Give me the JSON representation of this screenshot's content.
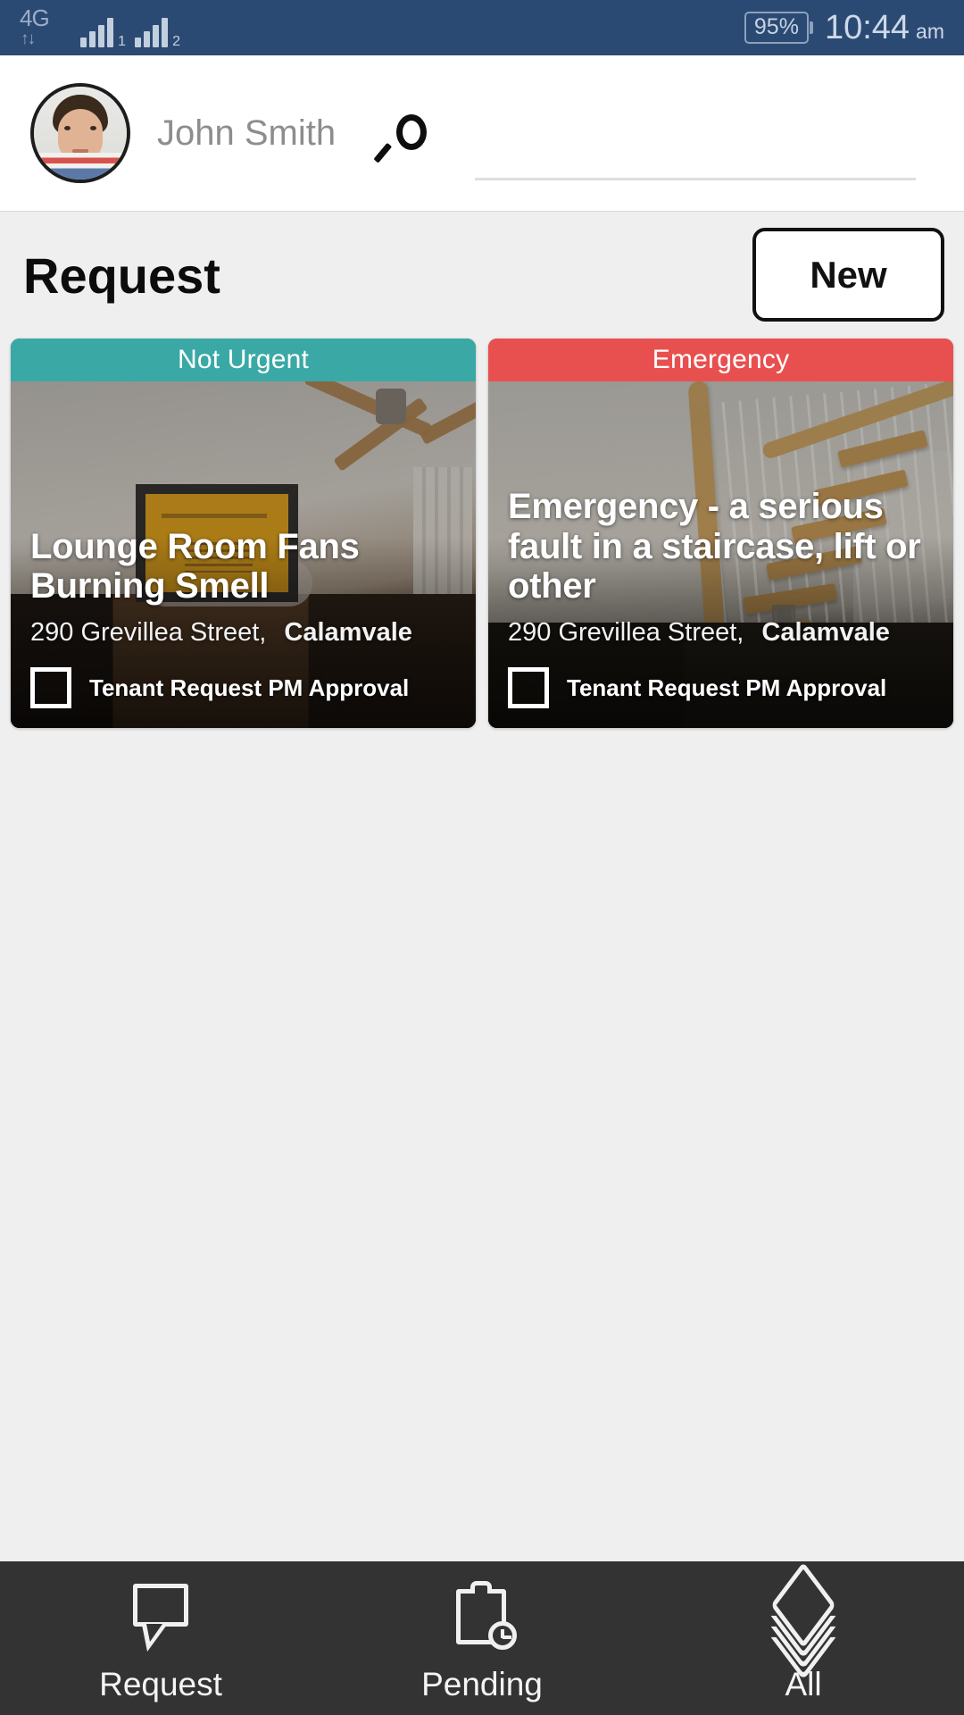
{
  "statusbar": {
    "network_type": "4G",
    "data_arrows": "↑↓",
    "sim1_subscript": "1",
    "sim2_subscript": "2",
    "battery": "95%",
    "time": "10:44",
    "ampm": "am",
    "background_color": "#2b4a73"
  },
  "header": {
    "user_name": "John Smith",
    "avatar_name": "avatar",
    "search_icon": "search-icon",
    "search_value": "",
    "search_placeholder": ""
  },
  "page": {
    "title": "Request",
    "new_button": "New",
    "background_color": "#efefef"
  },
  "cards": [
    {
      "badge": "Not Urgent",
      "badge_color": "#3aa9a5",
      "title": "Lounge Room Fans Burning Smell",
      "address_street": "290 Grevillea Street,",
      "address_suburb": "Calamvale",
      "approval_label": "Tenant Request PM Approval",
      "approval_checked": false,
      "photo": "bedroom-ceiling-fan-photo"
    },
    {
      "badge": "Emergency",
      "badge_color": "#e8504f",
      "title": "Emergency - a serious fault in a staircase, lift or other",
      "address_street": "290 Grevillea Street,",
      "address_suburb": "Calamvale",
      "approval_label": "Tenant Request PM Approval",
      "approval_checked": false,
      "photo": "wooden-staircase-photo"
    }
  ],
  "bottom_nav": {
    "background_color": "#333333",
    "items": [
      {
        "label": "Request",
        "icon": "speech-bubble-icon",
        "active": true
      },
      {
        "label": "Pending",
        "icon": "clipboard-clock-icon",
        "active": false
      },
      {
        "label": "All",
        "icon": "layers-stack-icon",
        "active": false
      }
    ]
  }
}
